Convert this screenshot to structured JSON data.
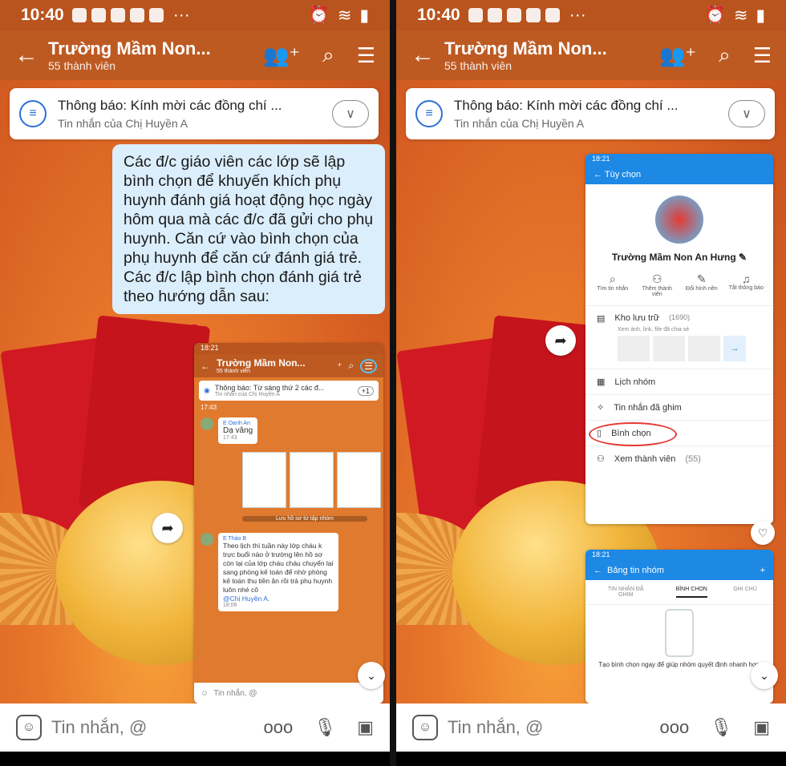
{
  "status": {
    "time": "10:40",
    "dots": "···"
  },
  "header": {
    "title": "Trường Mầm Non...",
    "subtitle": "55 thành viên"
  },
  "notice": {
    "title": "Thông báo: Kính mời các đồng chí ...",
    "sub": "Tin nhắn của Chị Huyền A"
  },
  "message": {
    "text": "Các đ/c giáo viên các lớp sẽ lập bình chọn để khuyến khích phụ huynh đánh giá hoạt động học ngày hôm qua mà các đ/c đã gửi cho phụ huynh. Căn cứ vào bình chọn của phụ huynh để căn cứ đánh giá trẻ. Các đ/c lập bình chọn đánh giá trẻ theo hướng dẫn sau:"
  },
  "inner_left": {
    "time": "18:21",
    "title": "Trường Mầm Non...",
    "subtitle": "55 thành viên",
    "notice_title": "Thông báo: Từ sáng thứ 2 các đ...",
    "notice_sub": "Tin nhắn của Chị Huyền A",
    "notice_badge": "+1",
    "ts1": "17:43",
    "sender1": "E Oanh An",
    "reply1": "Dạ vâng",
    "ts2": "17:43",
    "saved_note": "Lưu hồ sơ từ tập nhóm",
    "sender2": "E Thảo B",
    "msg2": "Theo lịch thì tuần này lớp cháu k trực buổi nào ở trường lên hồ sơ còn lại của lớp cháu cháu chuyển lại sang phòng kế toán để nhờ phòng kế toán thu tiền ăn rồi trả phụ huynh luôn nhé cô",
    "mention": "@Chị Huyền A.",
    "ts3": "18:06",
    "input": "Tin nhắn, @"
  },
  "inner_right_top": {
    "time": "18:21",
    "header": "Tùy chọn",
    "group_name": "Trường Mầm Non An Hưng",
    "actions": [
      "Tìm tin nhắn",
      "Thêm thành viên",
      "Đổi hình nền",
      "Tắt thông báo"
    ],
    "storage": "Kho lưu trữ",
    "storage_count": "(1690)",
    "storage_sub": "Xem ảnh, link, file đã chia sẻ",
    "rows": [
      "Lịch nhóm",
      "Tin nhắn đã ghim",
      "Bình chọn",
      "Xem thành viên"
    ],
    "members_count": "(55)"
  },
  "inner_right_bottom": {
    "time": "18:21",
    "header": "Bảng tin nhóm",
    "plus": "+",
    "tabs": [
      "TIN NHẮN ĐÃ GHIM",
      "BÌNH CHỌN",
      "GHI CHÚ"
    ],
    "hint": "Tạo bình chọn ngay để giúp nhóm quyết định nhanh hơn"
  },
  "composer": {
    "placeholder": "Tin nhắn, @",
    "more": "ooo"
  },
  "colors": {
    "accent": "#bd5a22",
    "bubble": "#dbeefc",
    "blue": "#1e88e5"
  }
}
